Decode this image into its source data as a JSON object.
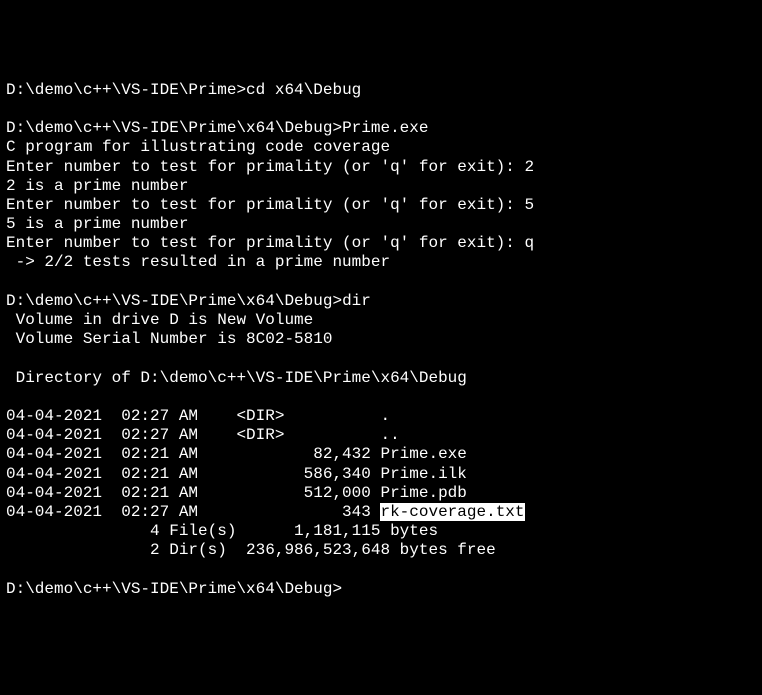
{
  "terminal": {
    "lines": [
      {
        "prompt": "D:\\demo\\c++\\VS-IDE\\Prime>",
        "cmd": "cd x64\\Debug"
      },
      {
        "text": ""
      },
      {
        "prompt": "D:\\demo\\c++\\VS-IDE\\Prime\\x64\\Debug>",
        "cmd": "Prime.exe"
      },
      {
        "text": "C program for illustrating code coverage"
      },
      {
        "text": "Enter number to test for primality (or 'q' for exit): 2"
      },
      {
        "text": "2 is a prime number"
      },
      {
        "text": "Enter number to test for primality (or 'q' for exit): 5"
      },
      {
        "text": "5 is a prime number"
      },
      {
        "text": "Enter number to test for primality (or 'q' for exit): q"
      },
      {
        "text": " -> 2/2 tests resulted in a prime number"
      },
      {
        "text": ""
      },
      {
        "prompt": "D:\\demo\\c++\\VS-IDE\\Prime\\x64\\Debug>",
        "cmd": "dir"
      },
      {
        "text": " Volume in drive D is New Volume"
      },
      {
        "text": " Volume Serial Number is 8C02-5810"
      },
      {
        "text": ""
      },
      {
        "text": " Directory of D:\\demo\\c++\\VS-IDE\\Prime\\x64\\Debug"
      },
      {
        "text": ""
      },
      {
        "text": "04-04-2021  02:27 AM    <DIR>          ."
      },
      {
        "text": "04-04-2021  02:27 AM    <DIR>          .."
      },
      {
        "text": "04-04-2021  02:21 AM            82,432 Prime.exe"
      },
      {
        "text": "04-04-2021  02:21 AM           586,340 Prime.ilk"
      },
      {
        "text": "04-04-2021  02:21 AM           512,000 Prime.pdb"
      },
      {
        "text": "04-04-2021  02:27 AM               343 ",
        "highlight": "rk-coverage.txt"
      },
      {
        "text": "               4 File(s)      1,181,115 bytes"
      },
      {
        "text": "               2 Dir(s)  236,986,523,648 bytes free"
      },
      {
        "text": ""
      },
      {
        "prompt": "D:\\demo\\c++\\VS-IDE\\Prime\\x64\\Debug>",
        "cmd": ""
      }
    ]
  }
}
